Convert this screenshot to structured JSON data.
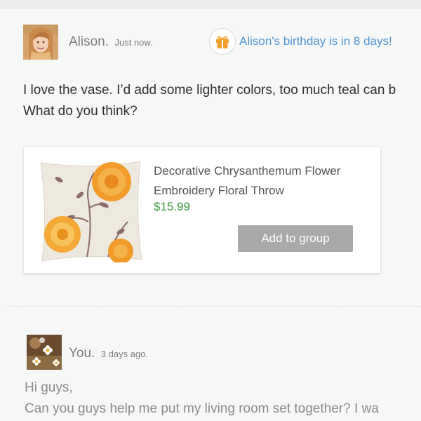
{
  "post_1": {
    "author": "Alison.",
    "timestamp": "Just now.",
    "birthday_notice": "Alison's birthday is in 8 days!",
    "message_line_1": "I love the vase. I’d add some lighter colors, too much teal can b",
    "message_line_2": "What do you think?",
    "product": {
      "title_line_1": "Decorative Chrysanthemum Flower",
      "title_line_2": "Embroidery Floral Throw",
      "price": "$15.99",
      "button_label": "Add to group"
    }
  },
  "post_2": {
    "author": "You.",
    "timestamp": "3 days ago.",
    "message_line_1": "Hi guys,",
    "message_line_2": "Can you guys help me put my living room set together? I wa"
  },
  "colors": {
    "background": "#f6f7f7",
    "link_blue": "#4f95cf",
    "price_green": "#3f9a3f",
    "button_gray": "#a9a9a9",
    "gift_orange": "#f4a12c"
  },
  "icons": {
    "gift": "gift-icon"
  }
}
